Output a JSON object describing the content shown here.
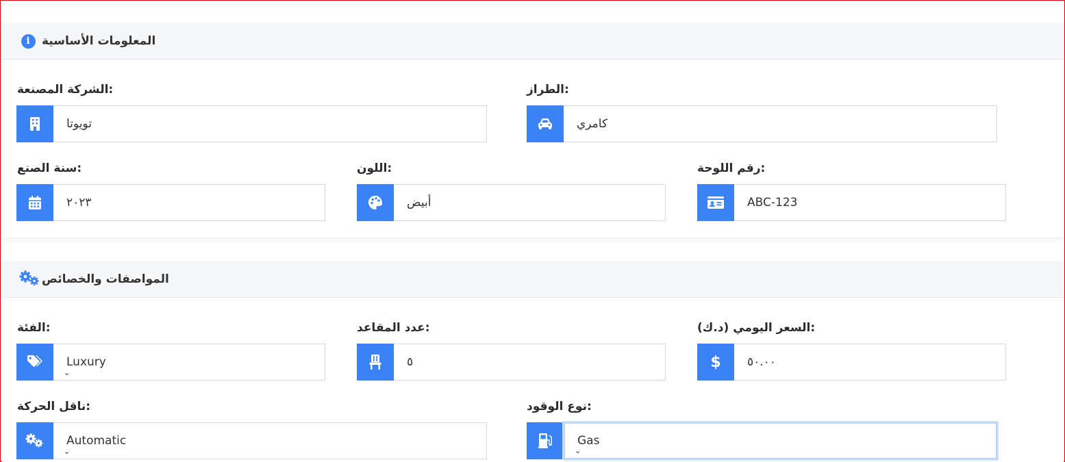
{
  "sections": {
    "basic": {
      "title": "المعلومات الأساسية",
      "icon": "info-icon",
      "fields": {
        "manufacturer": {
          "label": "الشركة المصنعة:",
          "value": "تويوتا",
          "icon": "building-icon"
        },
        "model": {
          "label": "الطراز:",
          "value": "كامري",
          "icon": "car-icon"
        },
        "year": {
          "label": "سنة الصنع:",
          "value": "٢٠٢٣",
          "icon": "calendar-icon"
        },
        "color": {
          "label": "اللون:",
          "value": "أبيض",
          "icon": "palette-icon"
        },
        "plate": {
          "label": "رقم اللوحة:",
          "value": "ABC-123",
          "icon": "id-card-icon"
        }
      }
    },
    "specs": {
      "title": "المواصفات والخصائص",
      "icon": "gears-icon",
      "fields": {
        "category": {
          "label": "الفئة:",
          "value": "Luxury",
          "icon": "tags-icon"
        },
        "seats": {
          "label": "عدد المقاعد:",
          "value": "٥",
          "icon": "chair-icon"
        },
        "daily_price": {
          "label": "السعر اليومي (د.ك):",
          "value": "٥٠.٠٠",
          "icon": "dollar-icon"
        },
        "transmission": {
          "label": "ناقل الحركة:",
          "value": "Automatic",
          "icon": "gears-icon"
        },
        "fuel": {
          "label": "نوع الوقود:",
          "value": "Gas",
          "icon": "gas-pump-icon"
        }
      }
    }
  },
  "colors": {
    "accent": "#3b82f6",
    "header_bg": "#f6f7f8",
    "border": "#d4d7db",
    "focus": "#b9d3fb"
  }
}
